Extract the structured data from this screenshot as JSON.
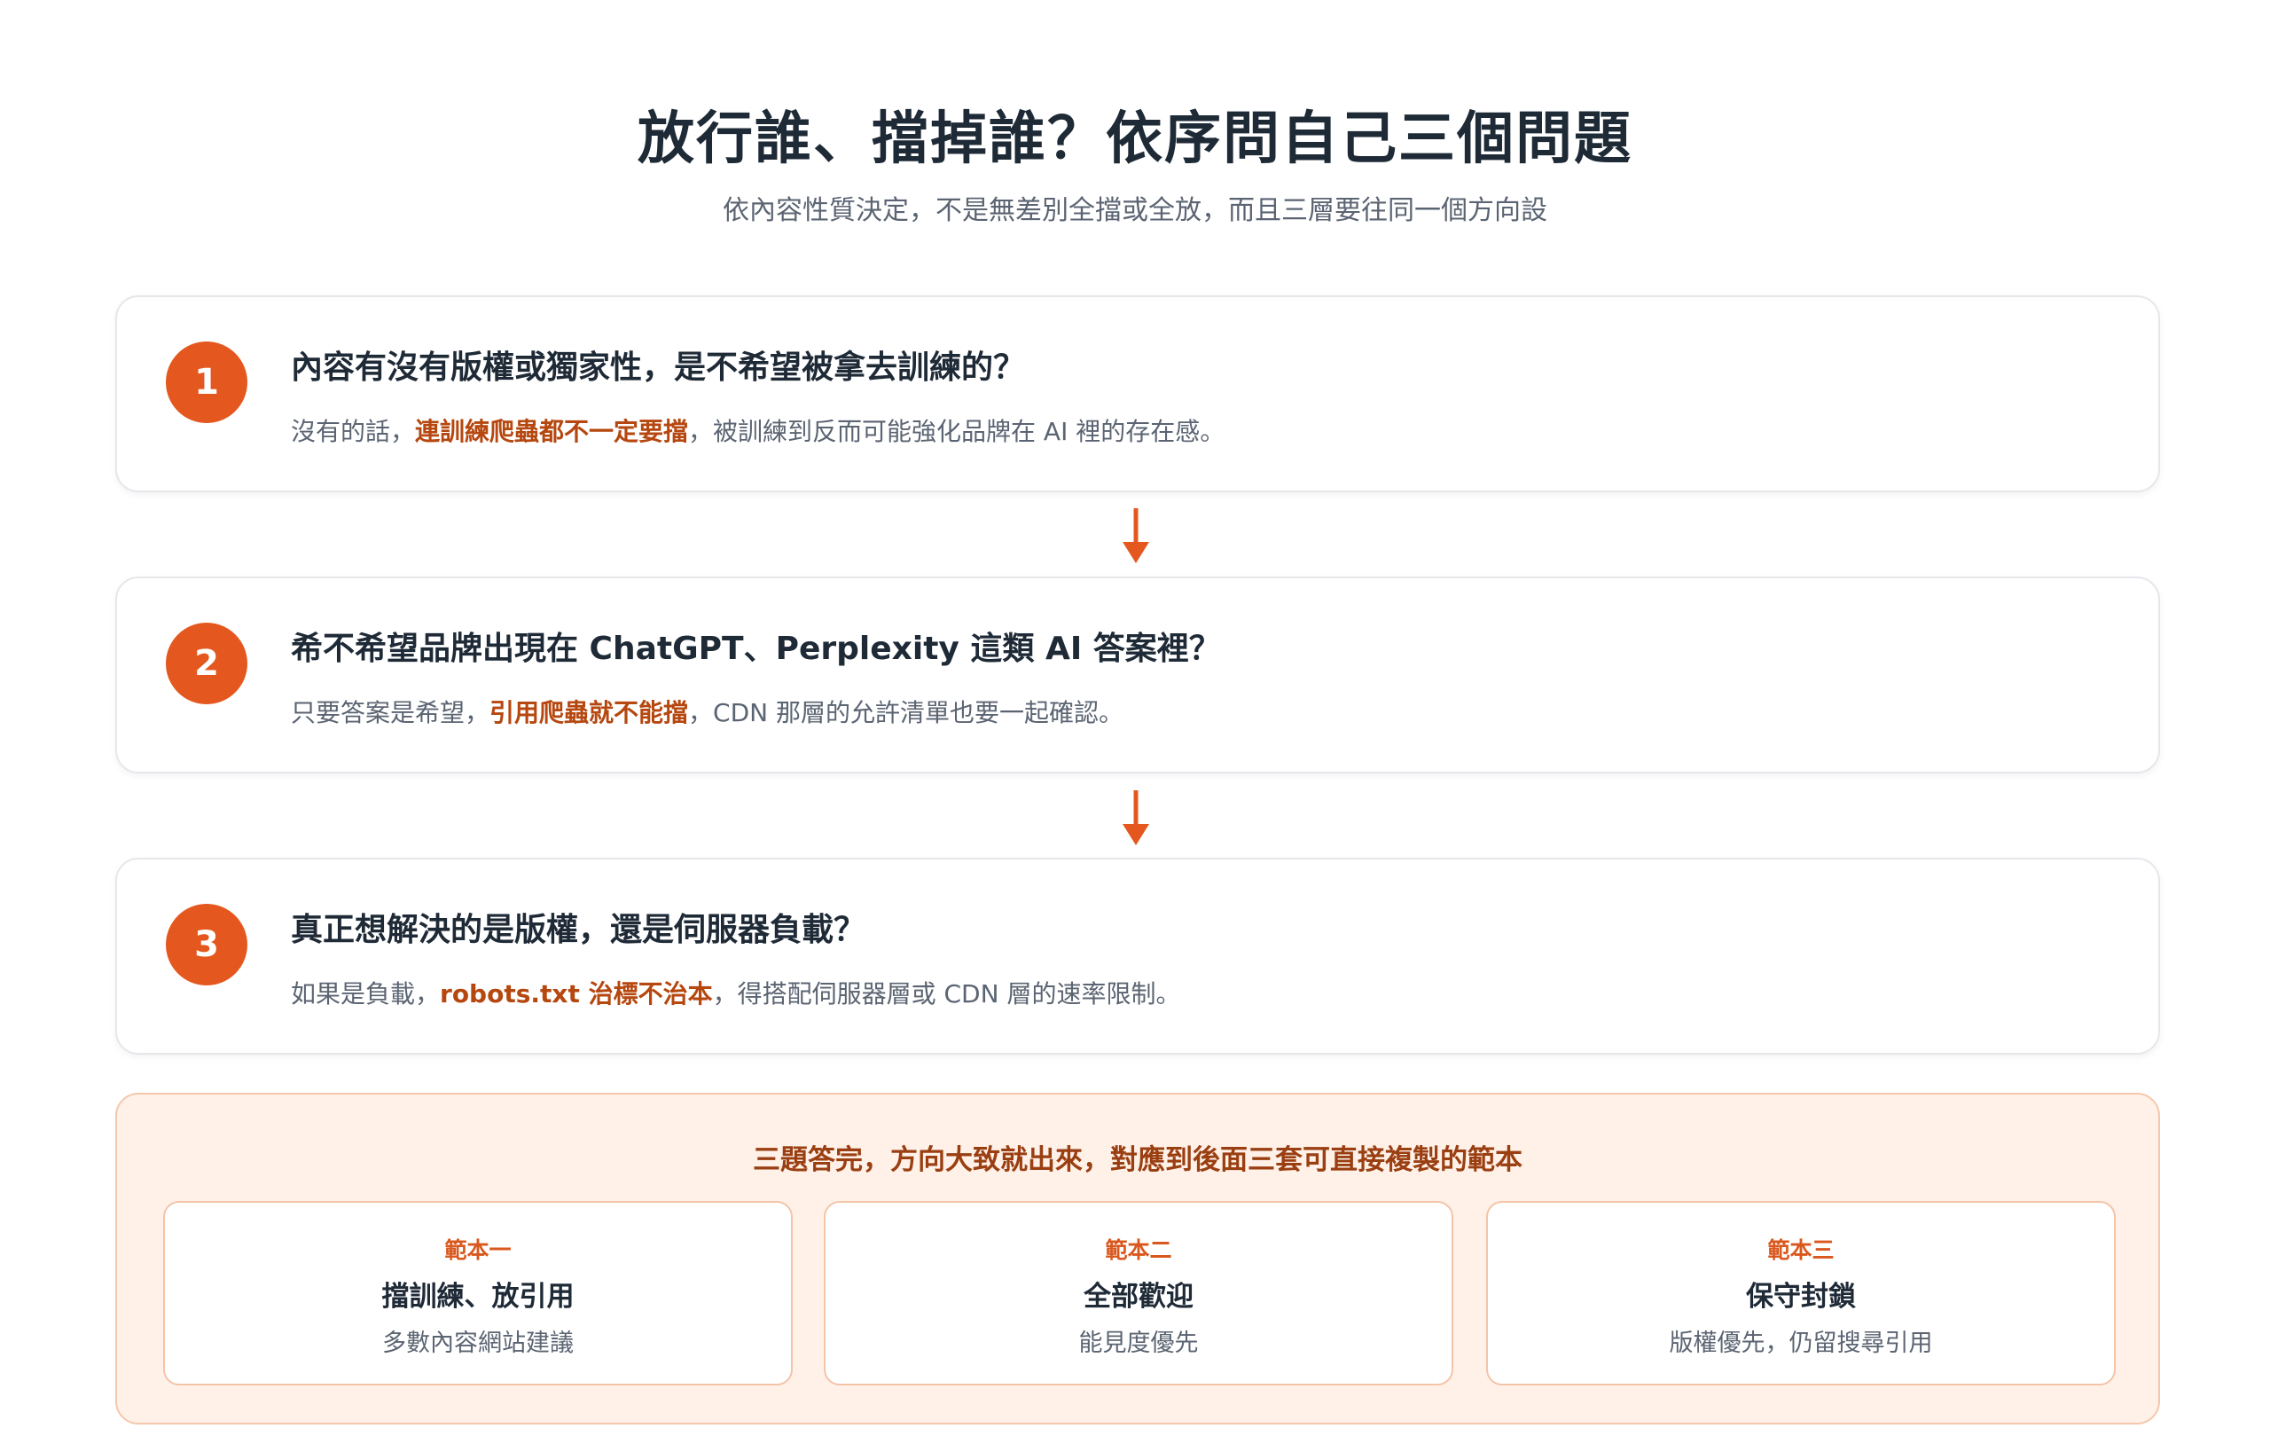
{
  "header": {
    "title": "放行誰、擋掉誰？依序問自己三個問題",
    "subtitle": "依內容性質決定，不是無差別全擋或全放，而且三層要往同一個方向設"
  },
  "steps": [
    {
      "number": "1",
      "question": "內容有沒有版權或獨家性，是不希望被拿去訓練的？",
      "answer_before": "沒有的話，",
      "answer_highlight": "連訓練爬蟲都不一定要擋",
      "answer_after": "，被訓練到反而可能強化品牌在 AI 裡的存在感。"
    },
    {
      "number": "2",
      "question": "希不希望品牌出現在 ChatGPT、Perplexity 這類 AI 答案裡？",
      "answer_before": "只要答案是希望，",
      "answer_highlight": "引用爬蟲就不能擋",
      "answer_after": "，CDN 那層的允許清單也要一起確認。"
    },
    {
      "number": "3",
      "question": "真正想解決的是版權，還是伺服器負載？",
      "answer_before": "如果是負載，",
      "answer_highlight": "robots.txt 治標不治本",
      "answer_after": "，得搭配伺服器層或 CDN 層的速率限制。"
    }
  ],
  "summary": {
    "heading": "三題答完，方向大致就出來，對應到後面三套可直接複製的範本",
    "templates": [
      {
        "tag": "範本一",
        "name": "擋訓練、放引用",
        "desc": "多數內容網站建議"
      },
      {
        "tag": "範本二",
        "name": "全部歡迎",
        "desc": "能見度優先"
      },
      {
        "tag": "範本三",
        "name": "保守封鎖",
        "desc": "版權優先，仍留搜尋引用"
      }
    ]
  },
  "colors": {
    "accent": "#e4581f",
    "highlight_text": "#b5470f",
    "summary_bg": "#fff1e8"
  },
  "icons": {
    "arrow": "arrow-down-icon"
  }
}
